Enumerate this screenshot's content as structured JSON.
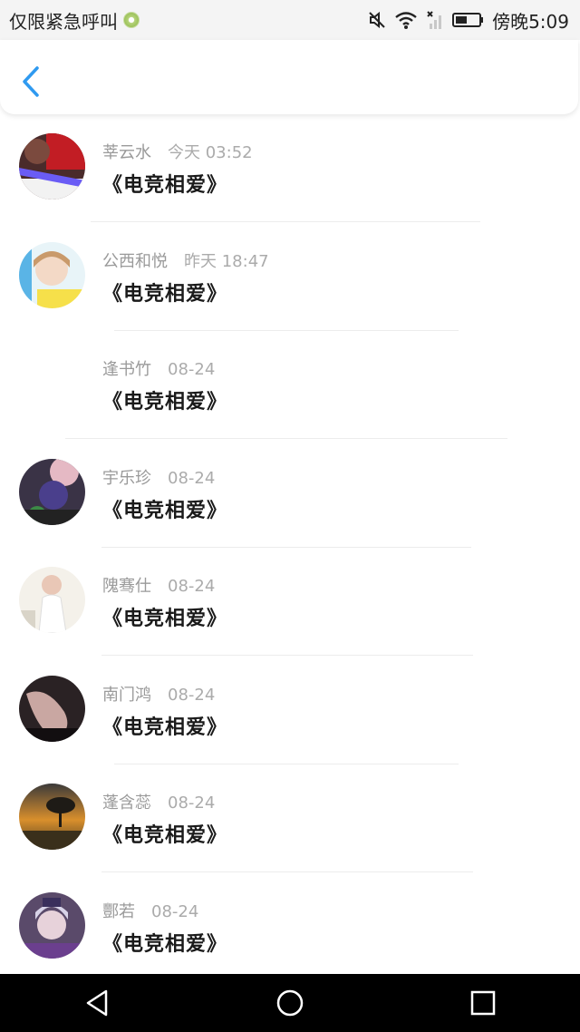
{
  "status_bar": {
    "left_text": "仅限紧急呼叫",
    "time": "傍晚5:09"
  },
  "header": {
    "back_icon": "chevron-left-icon",
    "accent_color": "#2f9af0"
  },
  "items": [
    {
      "name": "莘云水",
      "time": "今天 03:52",
      "title": "《电竞相爱》",
      "has_avatar": true
    },
    {
      "name": "公西和悦",
      "time": "昨天 18:47",
      "title": "《电竞相爱》",
      "has_avatar": true
    },
    {
      "name": "逢书竹",
      "time": "08-24",
      "title": "《电竞相爱》",
      "has_avatar": false
    },
    {
      "name": "宇乐珍",
      "time": "08-24",
      "title": "《电竞相爱》",
      "has_avatar": true
    },
    {
      "name": "隗骞仕",
      "time": "08-24",
      "title": "《电竞相爱》",
      "has_avatar": true
    },
    {
      "name": "南门鸿",
      "time": "08-24",
      "title": "《电竞相爱》",
      "has_avatar": true
    },
    {
      "name": "蓬含蕊",
      "time": "08-24",
      "title": "《电竞相爱》",
      "has_avatar": true
    },
    {
      "name": "酆若",
      "time": "08-24",
      "title": "《电竞相爱》",
      "has_avatar": true
    }
  ],
  "nav_bar": {
    "back_icon": "triangle-back-icon",
    "home_icon": "circle-home-icon",
    "recents_icon": "square-recents-icon"
  }
}
